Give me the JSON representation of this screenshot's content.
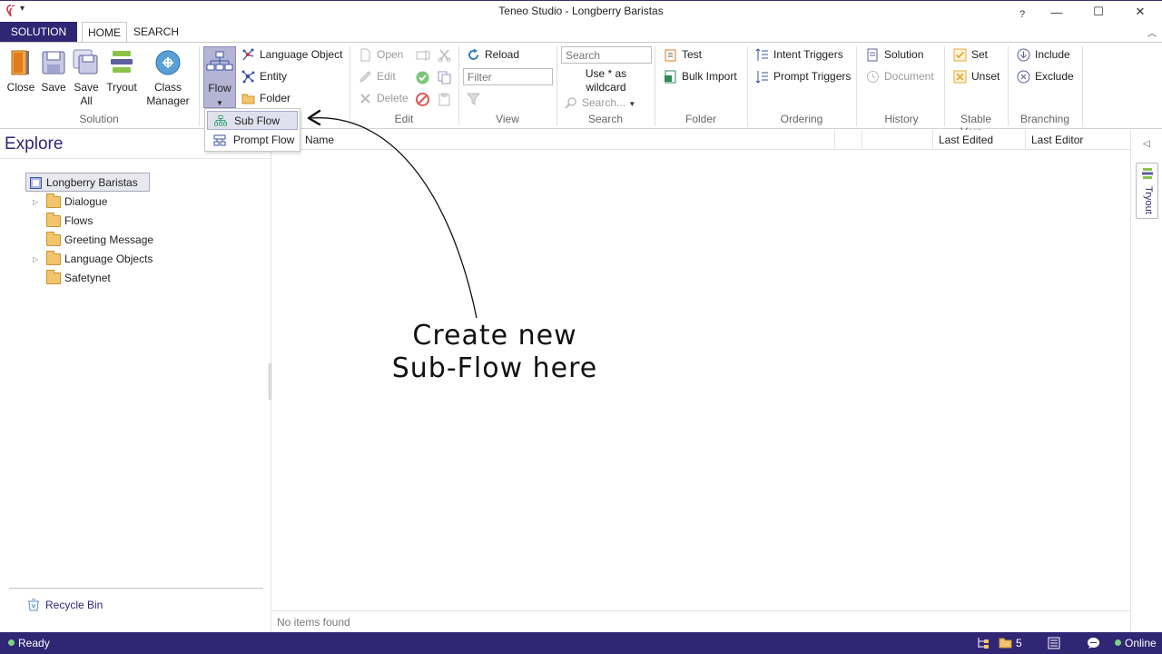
{
  "window": {
    "title": "Teneo Studio - Longberry Baristas",
    "help": "?",
    "minimize": "—",
    "maximize": "☐",
    "close": "✕"
  },
  "tabs": {
    "solution": "SOLUTION",
    "home": "HOME",
    "search": "SEARCH"
  },
  "ribbon": {
    "solution_group": {
      "label": "Solution",
      "close": "Close",
      "save": "Save",
      "save_all_1": "Save",
      "save_all_2": "All",
      "tryout": "Tryout",
      "class_manager_1": "Class",
      "class_manager_2": "Manager"
    },
    "new_group": {
      "flow": "Flow",
      "language_object": "Language Object",
      "entity": "Entity",
      "folder": "Folder"
    },
    "edit_group": {
      "label": "Edit",
      "open": "Open",
      "edit": "Edit",
      "delete": "Delete"
    },
    "view_group": {
      "label": "View",
      "reload": "Reload",
      "filter_placeholder": "Filter"
    },
    "search_group": {
      "label": "Search",
      "search_placeholder": "Search",
      "wildcard_1": "Use * as",
      "wildcard_2": "wildcard",
      "search_dropdown": "Search..."
    },
    "folder_group": {
      "label": "Folder",
      "test": "Test",
      "bulk_import": "Bulk Import"
    },
    "ordering_group": {
      "label": "Ordering",
      "intent_triggers": "Intent Triggers",
      "prompt_triggers": "Prompt Triggers"
    },
    "history_group": {
      "label": "History",
      "solution": "Solution",
      "document": "Document"
    },
    "stable_group": {
      "label": "Stable Vers...",
      "set": "Set",
      "unset": "Unset"
    },
    "branching_group": {
      "label": "Branching",
      "include": "Include",
      "exclude": "Exclude"
    }
  },
  "flow_dropdown": {
    "items": [
      "Sub Flow",
      "Prompt Flow"
    ]
  },
  "explore": {
    "title": "Explore",
    "root": "Longberry Baristas",
    "items": [
      "Dialogue",
      "Flows",
      "Greeting Message",
      "Language Objects",
      "Safetynet"
    ],
    "recycle_bin": "Recycle Bin"
  },
  "list": {
    "columns": [
      "Name",
      "Last Edited",
      "Last Editor"
    ],
    "empty": "No items found"
  },
  "rail": {
    "tryout": "Tryout"
  },
  "status": {
    "ready": "Ready",
    "count": "5",
    "online": "Online"
  },
  "annotation": {
    "line1": "Create new",
    "line2": "Sub-Flow here"
  },
  "colors": {
    "brand": "#302674",
    "selection": "#dfe1ee"
  }
}
